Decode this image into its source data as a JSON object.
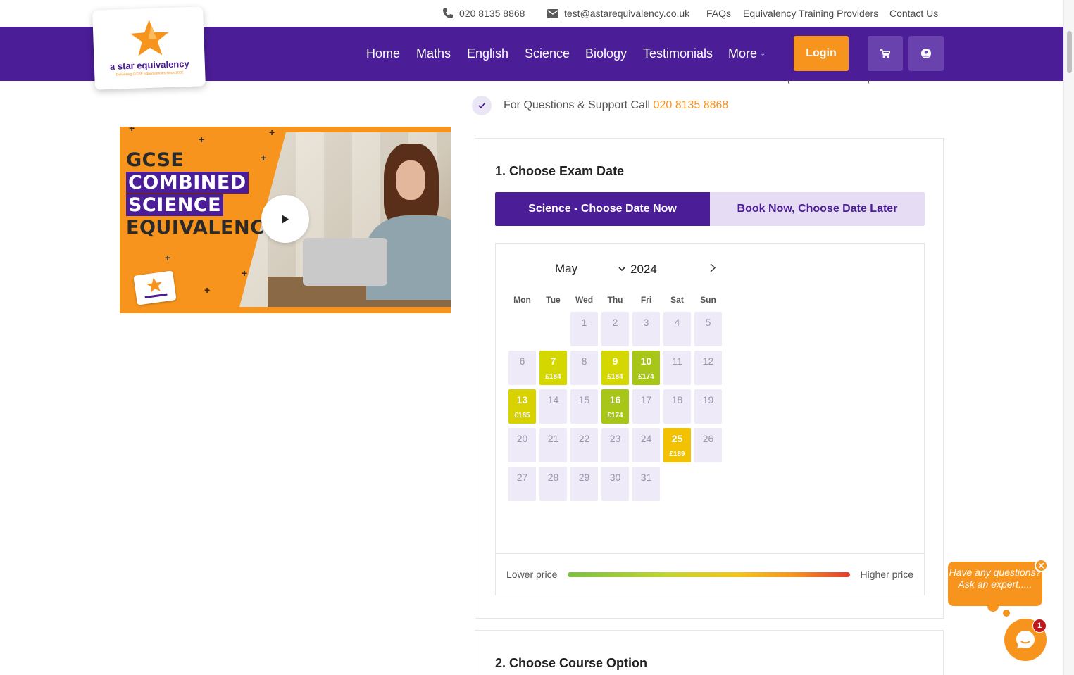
{
  "topbar": {
    "phone": "020 8135 8868",
    "email": "test@astarequivalency.co.uk",
    "links": [
      "FAQs",
      "Equivalency Training Providers",
      "Contact Us"
    ]
  },
  "logo": {
    "name": "a star equivalency",
    "tagline": "Delivering GCSE Equivalencies since 2002"
  },
  "nav": {
    "items": [
      "Home",
      "Maths",
      "English",
      "Science",
      "Biology",
      "Testimonials",
      "More"
    ],
    "login": "Login",
    "icons": [
      "cart-icon",
      "user-icon"
    ]
  },
  "support": {
    "text": "For Questions & Support Call",
    "phone": "020 8135 8868"
  },
  "video": {
    "lines": [
      "GCSE",
      "COMBINED",
      "SCIENCE",
      "EQUIVALENCY"
    ]
  },
  "exam_date": {
    "title": "1. Choose Exam Date",
    "tab_now": "Science - Choose Date Now",
    "tab_later": "Book Now, Choose Date Later",
    "month": "May",
    "year": "2024",
    "weekdays": [
      "Mon",
      "Tue",
      "Wed",
      "Thu",
      "Fri",
      "Sat",
      "Sun"
    ],
    "days": [
      {
        "n": "1"
      },
      {
        "n": "2"
      },
      {
        "n": "3"
      },
      {
        "n": "4"
      },
      {
        "n": "5"
      },
      {
        "n": "6"
      },
      {
        "n": "7",
        "price": "£184",
        "color": "#d4d800"
      },
      {
        "n": "8"
      },
      {
        "n": "9",
        "price": "£184",
        "color": "#d4d800"
      },
      {
        "n": "10",
        "price": "£174",
        "color": "#a8c617"
      },
      {
        "n": "11"
      },
      {
        "n": "12"
      },
      {
        "n": "13",
        "price": "£185",
        "color": "#d8d200"
      },
      {
        "n": "14"
      },
      {
        "n": "15"
      },
      {
        "n": "16",
        "price": "£174",
        "color": "#a8c617"
      },
      {
        "n": "17"
      },
      {
        "n": "18"
      },
      {
        "n": "19"
      },
      {
        "n": "20"
      },
      {
        "n": "21"
      },
      {
        "n": "22"
      },
      {
        "n": "23"
      },
      {
        "n": "24"
      },
      {
        "n": "25",
        "price": "£189",
        "color": "#f2c200"
      },
      {
        "n": "26"
      },
      {
        "n": "27"
      },
      {
        "n": "28"
      },
      {
        "n": "29"
      },
      {
        "n": "30"
      },
      {
        "n": "31"
      }
    ],
    "legend_low": "Lower price",
    "legend_high": "Higher price"
  },
  "course_option": {
    "title": "2. Choose Course Option"
  },
  "chat": {
    "prompt": "Have any questions? Ask an expert.....",
    "badge": "1"
  },
  "colors": {
    "brand_purple": "#4b1d96",
    "accent_orange": "#f7941d"
  }
}
